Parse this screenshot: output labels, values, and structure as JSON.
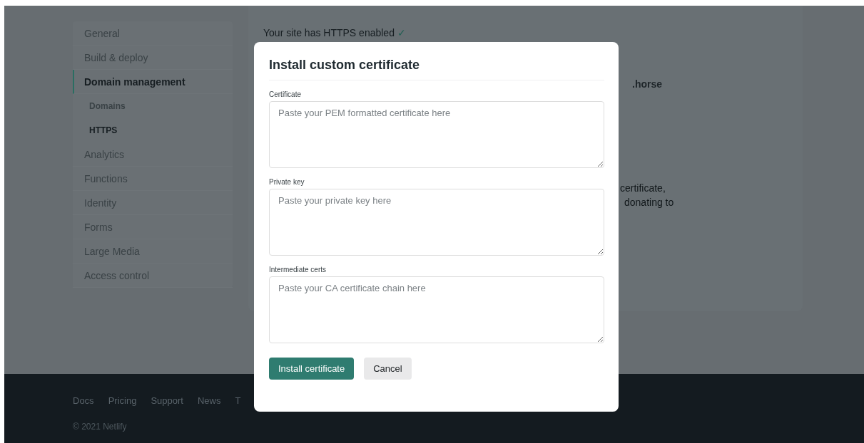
{
  "sidebar": {
    "items": [
      {
        "label": "General",
        "selected": false
      },
      {
        "label": "Build & deploy",
        "selected": false
      },
      {
        "label": "Domain management",
        "selected": true,
        "children": [
          {
            "label": "Domains",
            "selected": false
          },
          {
            "label": "HTTPS",
            "selected": true
          }
        ]
      },
      {
        "label": "Analytics",
        "selected": false
      },
      {
        "label": "Functions",
        "selected": false
      },
      {
        "label": "Identity",
        "selected": false
      },
      {
        "label": "Forms",
        "selected": false
      },
      {
        "label": "Large Media",
        "selected": false
      },
      {
        "label": "Access control",
        "selected": false
      }
    ]
  },
  "main": {
    "status": "Your site has HTTPS enabled",
    "status_icon": "✓",
    "fragments": [
      ".horse",
      "certificate,",
      "donating to"
    ]
  },
  "modal": {
    "title": "Install custom certificate",
    "fields": [
      {
        "label": "Certificate",
        "placeholder": "Paste your PEM formatted certificate here"
      },
      {
        "label": "Private key",
        "placeholder": "Paste your private key here"
      },
      {
        "label": "Intermediate certs",
        "placeholder": "Paste your CA certificate chain here"
      }
    ],
    "buttons": [
      {
        "label": "Install certificate",
        "kind": "primary"
      },
      {
        "label": "Cancel",
        "kind": "secondary"
      }
    ]
  },
  "footer": {
    "links": [
      "Docs",
      "Pricing",
      "Support",
      "News",
      "T"
    ],
    "copyright": "© 2021 Netlify"
  }
}
